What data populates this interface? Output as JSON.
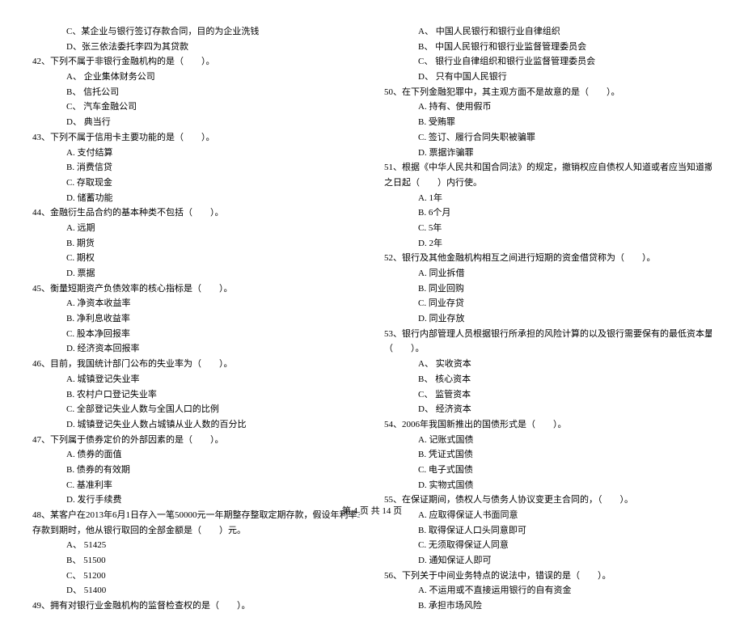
{
  "left": {
    "pre": [
      "C、某企业与银行签订存款合同，目的为企业洗钱",
      "D、张三依法委托李四为其贷款"
    ],
    "q42": {
      "stem": "42、下列不属于非银行金融机构的是（　　）。",
      "opts": [
        "A、 企业集体财务公司",
        "B、 信托公司",
        "C、 汽车金融公司",
        "D、 典当行"
      ]
    },
    "q43": {
      "stem": "43、下列不属于信用卡主要功能的是（　　）。",
      "opts": [
        "A. 支付结算",
        "B. 消费信贷",
        "C. 存取现金",
        "D. 储蓄功能"
      ]
    },
    "q44": {
      "stem": "44、金融衍生品合约的基本种类不包括（　　）。",
      "opts": [
        "A. 远期",
        "B. 期货",
        "C. 期权",
        "D. 票据"
      ]
    },
    "q45": {
      "stem": "45、衡量短期资产负债效率的核心指标是（　　）。",
      "opts": [
        "A. 净资本收益率",
        "B. 净利息收益率",
        "C. 股本净回报率",
        "D. 经济资本回报率"
      ]
    },
    "q46": {
      "stem": "46、目前，我国统计部门公布的失业率为（　　）。",
      "opts": [
        "A. 城镇登记失业率",
        "B. 农村户口登记失业率",
        "C. 全部登记失业人数与全国人口的比例",
        "D. 城镇登记失业人数占城镇从业人数的百分比"
      ]
    },
    "q47": {
      "stem": "47、下列属于债券定价的外部因素的是（　　）。",
      "opts": [
        "A. 债券的面值",
        "B. 债券的有效期",
        "C. 基准利率",
        "D. 发行手续费"
      ]
    },
    "q48": {
      "stem1": "48、某客户在2013年6月1日存入一笔50000元一年期整存整取定期存款，假设年利率3%，一年后",
      "stem2": "存款到期时，他从银行取回的全部金额是（　　）元。",
      "opts": [
        "A、 51425",
        "B、 51500",
        "C、 51200",
        "D、 51400"
      ]
    },
    "q49": {
      "stem": "49、拥有对银行业金融机构的监督检查权的是（　　）。"
    }
  },
  "right": {
    "pre": [
      "A、 中国人民银行和银行业自律组织",
      "B、 中国人民银行和银行业监督管理委员会",
      "C、 银行业自律组织和银行业监督管理委员会",
      "D、 只有中国人民银行"
    ],
    "q50": {
      "stem": "50、在下列金融犯罪中，其主观方面不是故意的是（　　）。",
      "opts": [
        "A. 持有、使用假币",
        "B. 受贿罪",
        "C. 签订、履行合同失职被骗罪",
        "D. 票据诈骗罪"
      ]
    },
    "q51": {
      "stem1": "51、根据《中华人民共和国合同法》的规定，撤销权应自债权人知道或者应当知道撤销权事由",
      "stem2": "之日起（　　）内行使。",
      "opts": [
        "A. 1年",
        "B. 6个月",
        "C. 5年",
        "D. 2年"
      ]
    },
    "q52": {
      "stem": "52、银行及其他金融机构相互之间进行短期的资金借贷称为（　　）。",
      "opts": [
        "A. 同业拆借",
        "B. 同业回购",
        "C. 同业存贷",
        "D. 同业存放"
      ]
    },
    "q53": {
      "stem1": "53、银行内部管理人员根据银行所承担的风险计算的以及银行需要保有的最低资本量称为",
      "stem2": "（　　）。",
      "opts": [
        "A、 实收资本",
        "B、 核心资本",
        "C、 监管资本",
        "D、 经济资本"
      ]
    },
    "q54": {
      "stem": "54、2006年我国新推出的国债形式是（　　）。",
      "opts": [
        "A. 记账式国债",
        "B. 凭证式国债",
        "C. 电子式国债",
        "D. 实物式国债"
      ]
    },
    "q55": {
      "stem": "55、在保证期间，债权人与债务人协议变更主合同的，（　　）。",
      "opts": [
        "A. 应取得保证人书面同意",
        "B. 取得保证人口头同意即可",
        "C. 无须取得保证人同意",
        "D. 通知保证人即可"
      ]
    },
    "q56": {
      "stem": "56、下列关于中间业务特点的说法中，错误的是（　　）。",
      "opts": [
        "A. 不运用或不直接运用银行的自有资金",
        "B. 承担市场风险"
      ]
    }
  },
  "footer": "第 4 页 共 14 页"
}
